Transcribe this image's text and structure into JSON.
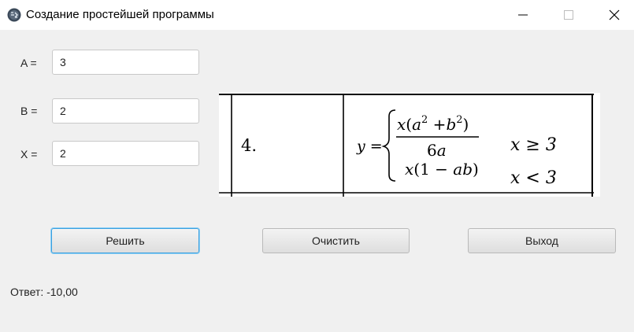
{
  "window": {
    "title": "Создание простейшей программы",
    "app_icon": "java-app-icon",
    "controls": [
      "minimize-icon",
      "maximize-icon",
      "close-icon"
    ]
  },
  "fields": {
    "a": {
      "label": "A =",
      "value": "3"
    },
    "b": {
      "label": "B =",
      "value": "2"
    },
    "x": {
      "label": "X =",
      "value": "2"
    }
  },
  "formula": {
    "number": "4.",
    "lhs": "y =",
    "case1_expr": "x(a² + b²) / 6a",
    "case1_cond": "x ≥ 3",
    "case2_expr": "x(1 − ab)",
    "case2_cond": "x < 3"
  },
  "buttons": {
    "solve": "Решить",
    "clear": "Очистить",
    "exit": "Выход"
  },
  "answer": {
    "text": "Ответ: -10,00"
  },
  "colors": {
    "window_bg": "#f0f0f0",
    "titlebar_bg": "#ffffff",
    "focus_border": "#3aa0e0"
  }
}
